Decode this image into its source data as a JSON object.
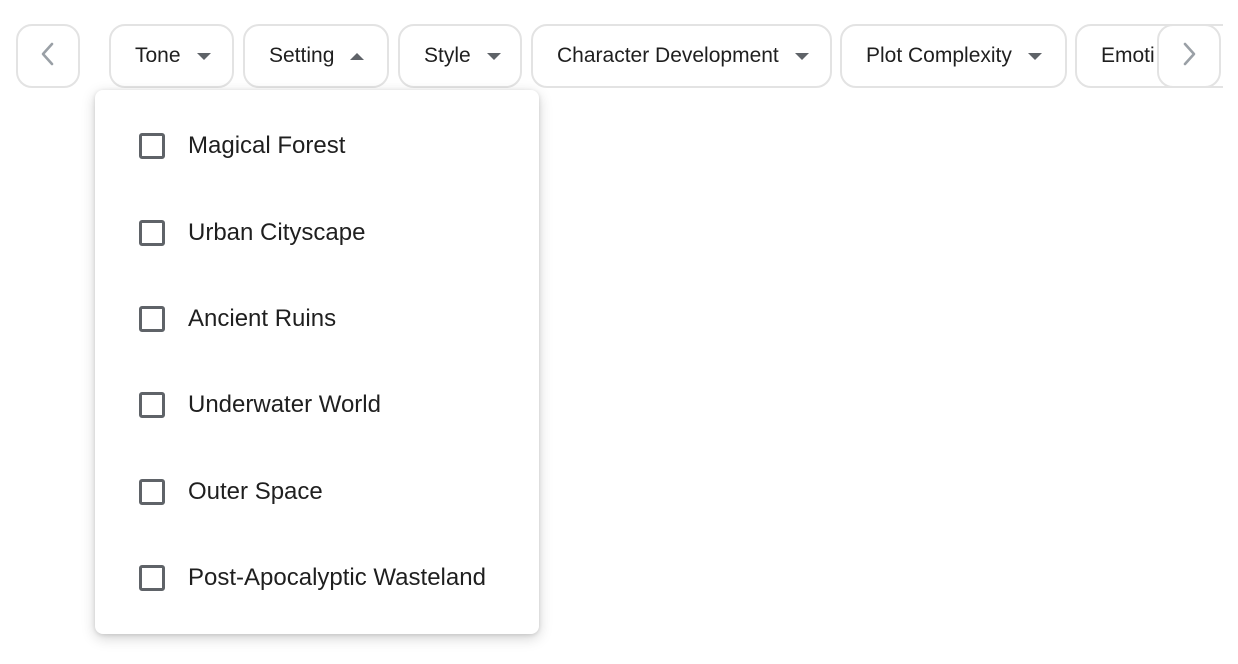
{
  "filters": {
    "chips": [
      {
        "label": "Tone",
        "state": "collapsed"
      },
      {
        "label": "Setting",
        "state": "expanded"
      },
      {
        "label": "Style",
        "state": "collapsed"
      },
      {
        "label": "Character Development",
        "state": "collapsed"
      },
      {
        "label": "Plot Complexity",
        "state": "collapsed"
      },
      {
        "label": "Emoti",
        "state": "collapsed"
      }
    ],
    "prev_icon": "chevron-left-icon",
    "next_icon": "chevron-right-icon"
  },
  "setting_dropdown": {
    "options": [
      {
        "label": "Magical Forest",
        "checked": false
      },
      {
        "label": "Urban Cityscape",
        "checked": false
      },
      {
        "label": "Ancient Ruins",
        "checked": false
      },
      {
        "label": "Underwater World",
        "checked": false
      },
      {
        "label": "Outer Space",
        "checked": false
      },
      {
        "label": "Post-Apocalyptic Wasteland",
        "checked": false
      }
    ]
  },
  "colors": {
    "border": "#e3e3e3",
    "icon": "#5f6368",
    "text": "#1f1f1f"
  }
}
